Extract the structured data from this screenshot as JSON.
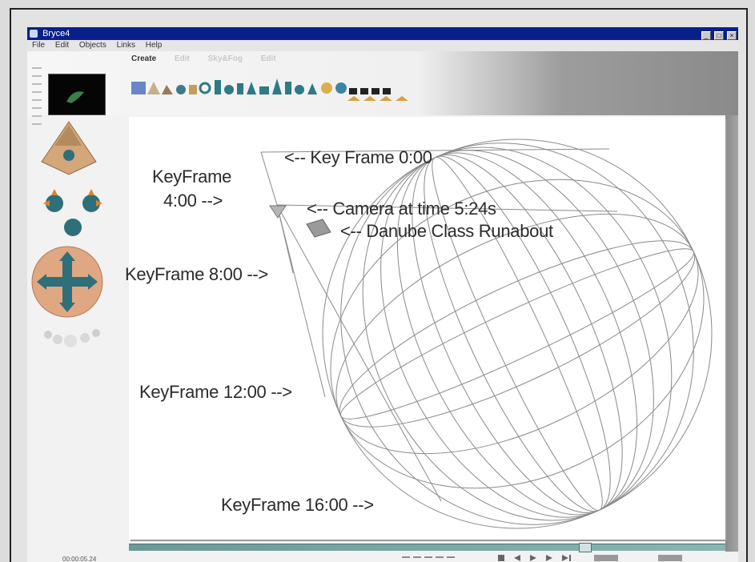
{
  "window": {
    "title": "Bryce4"
  },
  "menu": [
    "File",
    "Edit",
    "Objects",
    "Links",
    "Help"
  ],
  "tabs": [
    "Create",
    "Edit",
    "Sky&Fog",
    "Edit"
  ],
  "status": {
    "timecode": "00:00:05.24"
  },
  "annotations": {
    "key_frame_0": "<-- Key Frame 0:00",
    "keyframe_4_line1": "KeyFrame",
    "keyframe_4_line2": "4:00 -->",
    "camera": "<-- Camera at time 5:24s",
    "runabout": "<-- Danube Class Runabout",
    "keyframe_8": "KeyFrame 8:00 -->",
    "keyframe_12": "KeyFrame 12:00 -->",
    "keyframe_16": "KeyFrame 16:00 -->"
  },
  "icons": {
    "app": "bryce-app-icon",
    "minimize": "minimize-icon",
    "maximize": "maximize-icon",
    "close": "close-icon",
    "camera": "camera-icon",
    "runabout": "ship-icon",
    "cross_arrows": "cross-arrows-icon"
  },
  "colors": {
    "titlebar": "#0a1f8a",
    "timeline": "#7aa9a6",
    "wireframe": "#8a8a8a"
  },
  "timeline": {
    "position_fraction": 0.76
  }
}
